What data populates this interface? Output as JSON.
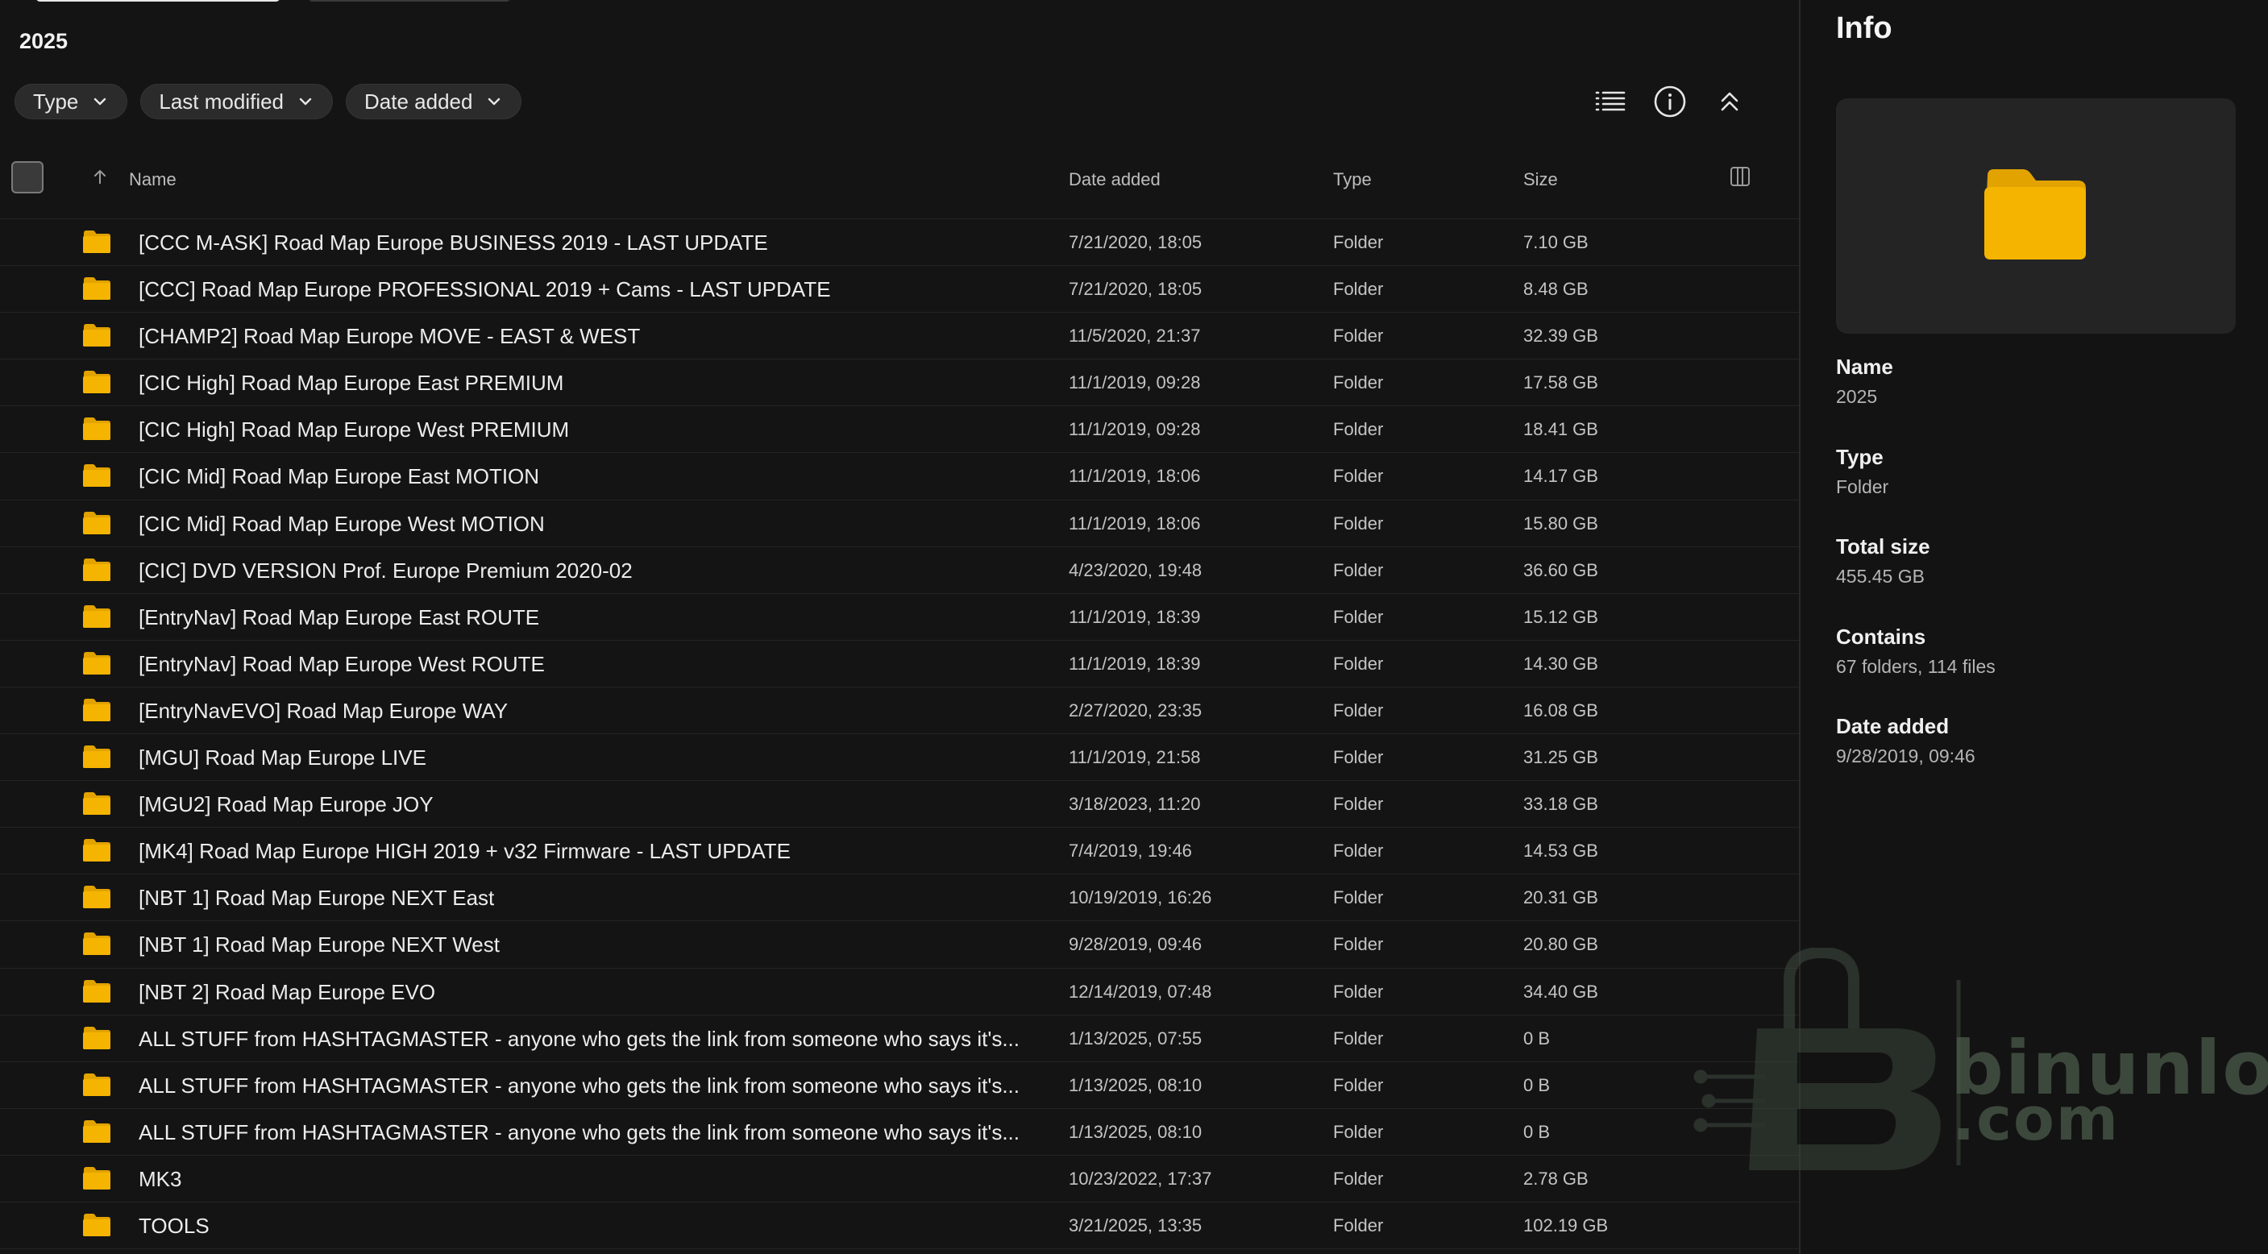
{
  "folder": {
    "title": "2025"
  },
  "filters": [
    {
      "label": "Type"
    },
    {
      "label": "Last modified"
    },
    {
      "label": "Date added"
    }
  ],
  "table": {
    "columns": {
      "name": "Name",
      "date_added": "Date added",
      "type": "Type",
      "size": "Size"
    },
    "rows": [
      {
        "name": "[CCC M-ASK] Road Map Europe BUSINESS 2019 - LAST UPDATE",
        "date": "7/21/2020, 18:05",
        "type": "Folder",
        "size": "7.10 GB"
      },
      {
        "name": "[CCC] Road Map Europe PROFESSIONAL 2019 + Cams - LAST UPDATE",
        "date": "7/21/2020, 18:05",
        "type": "Folder",
        "size": "8.48 GB"
      },
      {
        "name": "[CHAMP2] Road Map Europe MOVE - EAST & WEST",
        "date": "11/5/2020, 21:37",
        "type": "Folder",
        "size": "32.39 GB"
      },
      {
        "name": "[CIC High] Road Map Europe East PREMIUM",
        "date": "11/1/2019, 09:28",
        "type": "Folder",
        "size": "17.58 GB"
      },
      {
        "name": "[CIC High] Road Map Europe West PREMIUM",
        "date": "11/1/2019, 09:28",
        "type": "Folder",
        "size": "18.41 GB"
      },
      {
        "name": "[CIC Mid] Road Map Europe East MOTION",
        "date": "11/1/2019, 18:06",
        "type": "Folder",
        "size": "14.17 GB"
      },
      {
        "name": "[CIC Mid] Road Map Europe West MOTION",
        "date": "11/1/2019, 18:06",
        "type": "Folder",
        "size": "15.80 GB"
      },
      {
        "name": "[CIC] DVD VERSION Prof. Europe Premium 2020-02",
        "date": "4/23/2020, 19:48",
        "type": "Folder",
        "size": "36.60 GB"
      },
      {
        "name": "[EntryNav] Road Map Europe East ROUTE",
        "date": "11/1/2019, 18:39",
        "type": "Folder",
        "size": "15.12 GB"
      },
      {
        "name": "[EntryNav] Road Map Europe West ROUTE",
        "date": "11/1/2019, 18:39",
        "type": "Folder",
        "size": "14.30 GB"
      },
      {
        "name": "[EntryNavEVO] Road Map Europe WAY",
        "date": "2/27/2020, 23:35",
        "type": "Folder",
        "size": "16.08 GB"
      },
      {
        "name": "[MGU] Road Map Europe LIVE",
        "date": "11/1/2019, 21:58",
        "type": "Folder",
        "size": "31.25 GB"
      },
      {
        "name": "[MGU2] Road Map Europe JOY",
        "date": "3/18/2023, 11:20",
        "type": "Folder",
        "size": "33.18 GB"
      },
      {
        "name": "[MK4] Road Map Europe HIGH 2019 + v32 Firmware - LAST UPDATE",
        "date": "7/4/2019, 19:46",
        "type": "Folder",
        "size": "14.53 GB"
      },
      {
        "name": "[NBT 1] Road Map Europe NEXT East",
        "date": "10/19/2019, 16:26",
        "type": "Folder",
        "size": "20.31 GB"
      },
      {
        "name": "[NBT 1] Road Map Europe NEXT West",
        "date": "9/28/2019, 09:46",
        "type": "Folder",
        "size": "20.80 GB"
      },
      {
        "name": "[NBT 2] Road Map Europe EVO",
        "date": "12/14/2019, 07:48",
        "type": "Folder",
        "size": "34.40 GB"
      },
      {
        "name": "ALL STUFF from HASHTAGMASTER - anyone who gets the link from someone who says it's...",
        "date": "1/13/2025, 07:55",
        "type": "Folder",
        "size": "0 B"
      },
      {
        "name": "ALL STUFF from HASHTAGMASTER - anyone who gets the link from someone who says it's...",
        "date": "1/13/2025, 08:10",
        "type": "Folder",
        "size": "0 B"
      },
      {
        "name": "ALL STUFF from HASHTAGMASTER - anyone who gets the link from someone who says it's...",
        "date": "1/13/2025, 08:10",
        "type": "Folder",
        "size": "0 B"
      },
      {
        "name": "MK3",
        "date": "10/23/2022, 17:37",
        "type": "Folder",
        "size": "2.78 GB"
      },
      {
        "name": "TOOLS",
        "date": "3/21/2025, 13:35",
        "type": "Folder",
        "size": "102.19 GB"
      }
    ]
  },
  "info": {
    "title": "Info",
    "props": [
      {
        "key": "Name",
        "value": "2025"
      },
      {
        "key": "Type",
        "value": "Folder"
      },
      {
        "key": "Total size",
        "value": "455.45 GB"
      },
      {
        "key": "Contains",
        "value": "67 folders, 114 files"
      },
      {
        "key": "Date added",
        "value": "9/28/2019, 09:46"
      }
    ]
  },
  "watermark": {
    "line1": "binunlock",
    "line2": ".com"
  },
  "colors": {
    "folder": "#F5B400",
    "folder_dark": "#E2A300",
    "background": "#141414",
    "panel": "#131313",
    "card": "#242424"
  },
  "icons": [
    "chevron-down-icon",
    "list-view-icon",
    "info-icon",
    "collapse-icon",
    "sort-up-icon",
    "columns-icon",
    "folder-icon"
  ]
}
